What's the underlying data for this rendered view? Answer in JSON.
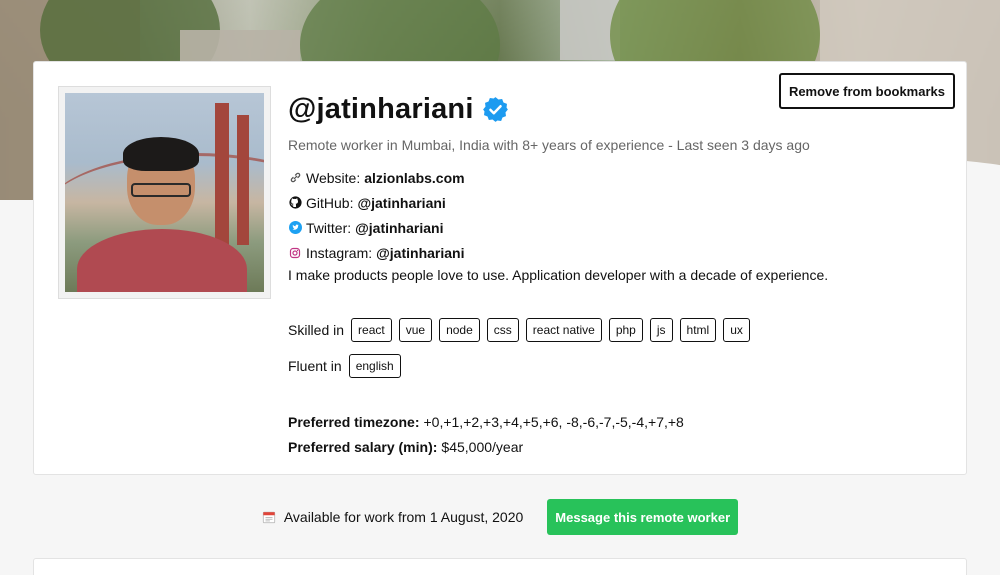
{
  "profile": {
    "username": "@jatinhariani",
    "verified_icon": "verified-badge-icon",
    "subtitle": "Remote worker in Mumbai, India with 8+ years of experience - Last seen 3 days ago",
    "links": [
      {
        "icon": "link-icon",
        "label": "Website:",
        "value": "alzionlabs.com"
      },
      {
        "icon": "github-icon",
        "label": "GitHub:",
        "value": "@jatinhariani"
      },
      {
        "icon": "twitter-icon",
        "label": "Twitter:",
        "value": "@jatinhariani"
      },
      {
        "icon": "instagram-icon",
        "label": "Instagram:",
        "value": "@jatinhariani"
      }
    ],
    "bio": "I make products people love to use. Application developer with a decade of experience.",
    "skilled_label": "Skilled in",
    "skills": [
      "react",
      "vue",
      "node",
      "css",
      "react native",
      "php",
      "js",
      "html",
      "ux"
    ],
    "fluent_label": "Fluent in",
    "languages": [
      "english"
    ],
    "timezone_label": "Preferred timezone:",
    "timezone_value": "+0,+1,+2,+3,+4,+5,+6, -8,-6,-7,-5,-4,+7,+8",
    "salary_label": "Preferred salary (min):",
    "salary_value": "$45,000/year"
  },
  "actions": {
    "bookmark_label": "Remove from bookmarks",
    "message_label": "Message this remote worker"
  },
  "availability": {
    "icon": "calendar-icon",
    "text": "Available for work from 1 August, 2020"
  },
  "colors": {
    "verified": "#1d9bf0",
    "twitter": "#1da1f2",
    "instagram": "#c13584",
    "message_button": "#28c25a"
  }
}
